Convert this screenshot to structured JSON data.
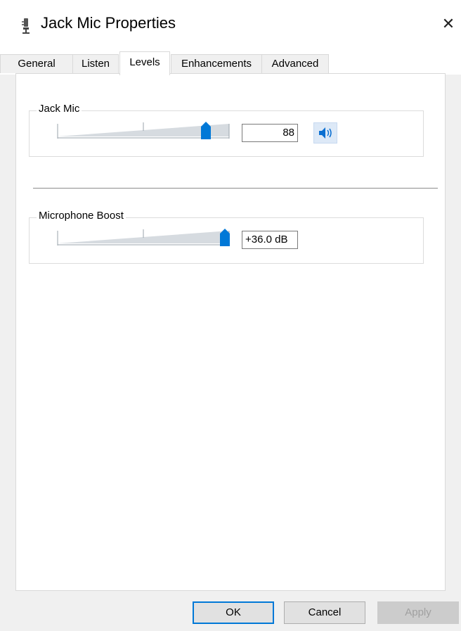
{
  "window": {
    "title": "Jack Mic Properties",
    "close_glyph": "✕"
  },
  "tabs": [
    {
      "label": "General",
      "active": false
    },
    {
      "label": "Listen",
      "active": false
    },
    {
      "label": "Levels",
      "active": true
    },
    {
      "label": "Enhancements",
      "active": false
    },
    {
      "label": "Advanced",
      "active": false
    }
  ],
  "levels": {
    "jack_mic": {
      "label": "Jack Mic",
      "value": "88",
      "level_percent": 88,
      "mute_icon": "speaker-icon"
    },
    "microphone_boost": {
      "label": "Microphone Boost",
      "value": "+36.0 dB",
      "level_fraction": 1.0
    }
  },
  "buttons": {
    "ok": "OK",
    "cancel": "Cancel",
    "apply": "Apply"
  },
  "colors": {
    "accent": "#0078d7",
    "slider_track": "#d6dbe0"
  }
}
